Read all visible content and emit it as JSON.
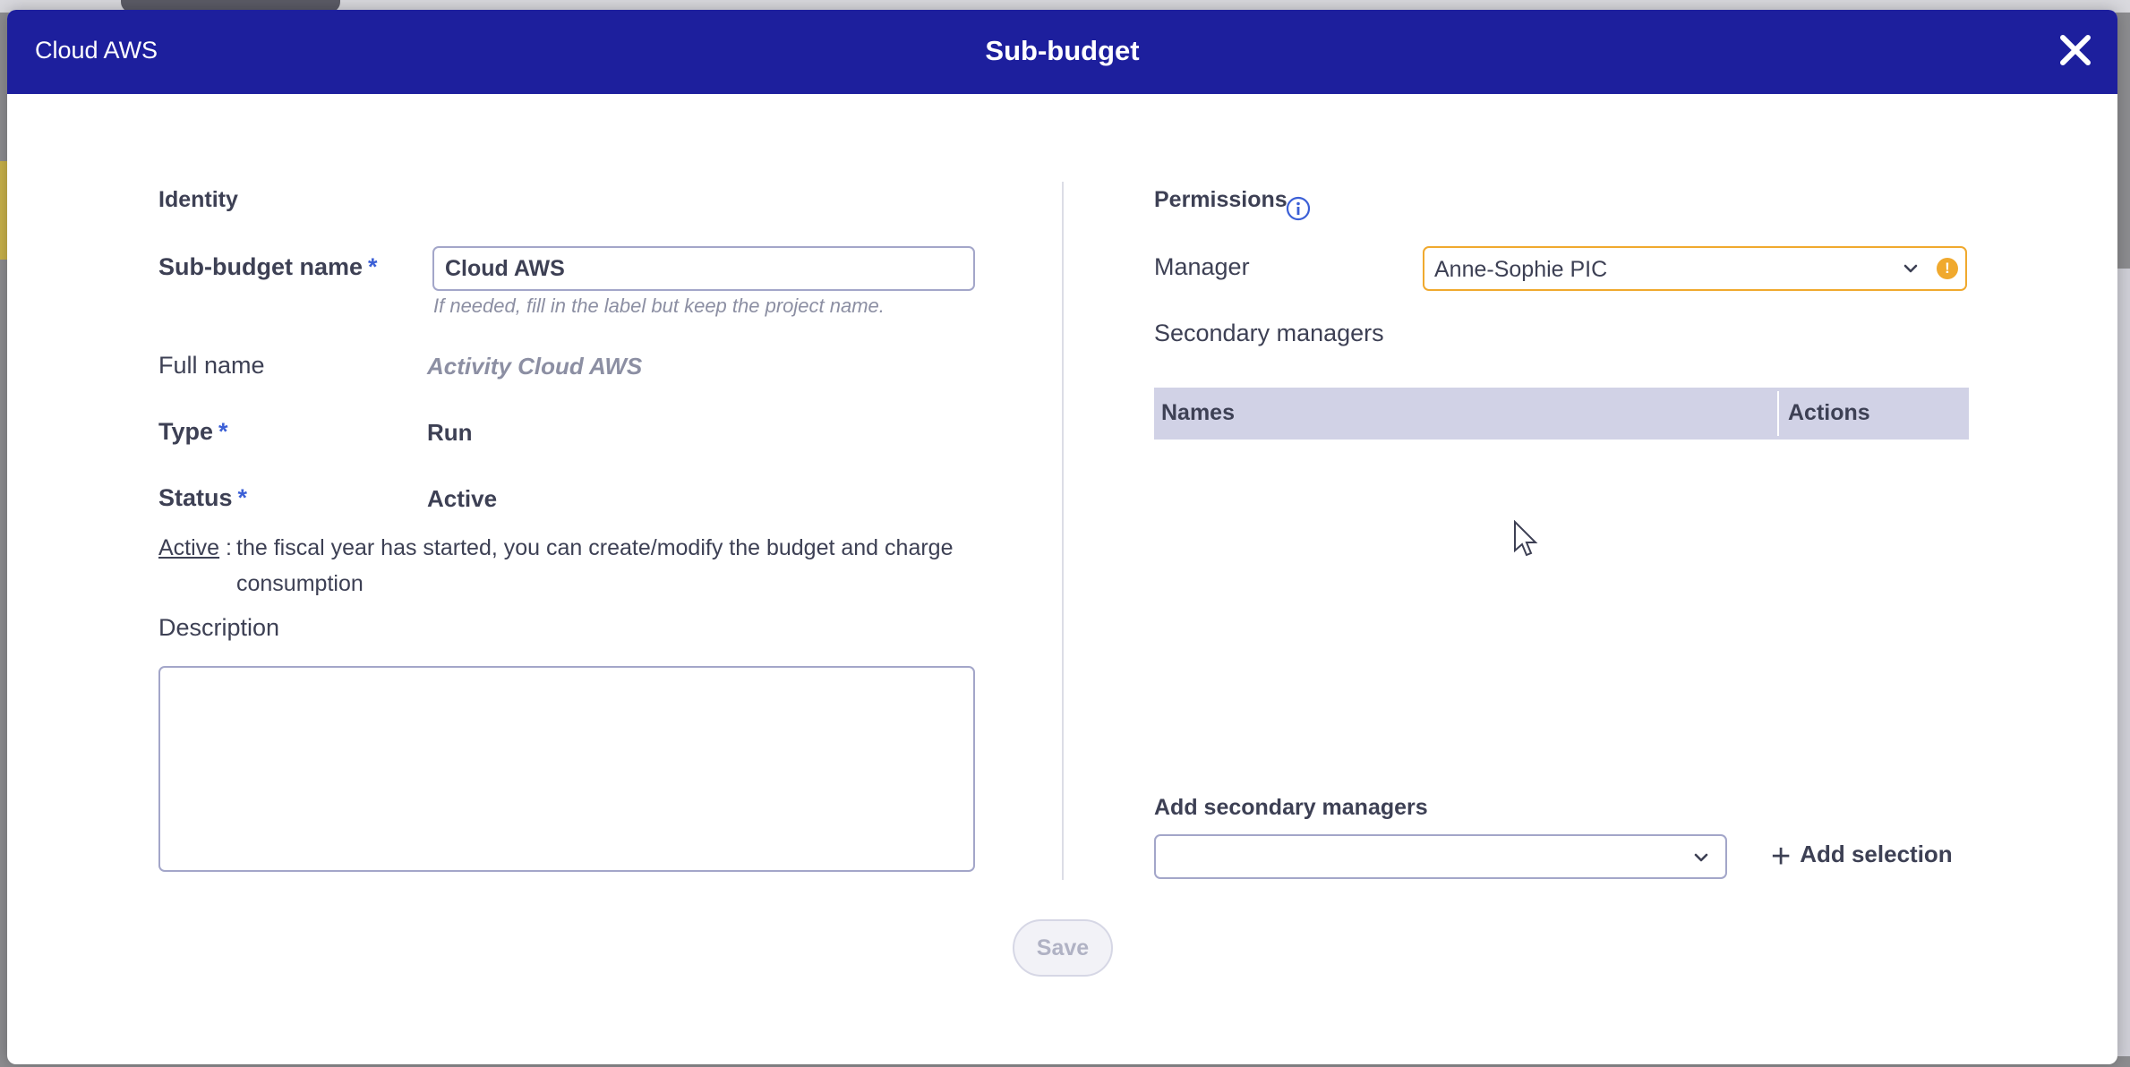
{
  "header": {
    "context": "Cloud AWS",
    "title": "Sub-budget",
    "close_icon": "close-icon"
  },
  "identity": {
    "section_title": "Identity",
    "name_label": "Sub-budget name",
    "name_value": "Cloud AWS",
    "name_hint": "If needed, fill in the label but keep the project name.",
    "fullname_label": "Full name",
    "fullname_value": "Activity Cloud AWS",
    "type_label": "Type",
    "type_value": "Run",
    "status_label": "Status",
    "status_value": "Active",
    "status_term": "Active",
    "status_colon": " :",
    "status_desc_line1": "the fiscal year has started, you can create/modify the budget and charge",
    "status_desc_line2": "consumption",
    "description_label": "Description",
    "description_value": "",
    "required_mark": "*"
  },
  "permissions": {
    "section_title": "Permissions",
    "info_icon": "info-icon",
    "manager_label": "Manager",
    "manager_value": "Anne-Sophie PIC",
    "manager_warning": "!",
    "secondary_label": "Secondary managers",
    "table_headers": [
      "Names",
      "Actions"
    ],
    "table_rows": [],
    "add_label": "Add secondary managers",
    "add_select_value": "",
    "add_button": "Add selection",
    "add_button_icon": "+"
  },
  "footer": {
    "save_label": "Save"
  },
  "colors": {
    "header_bg": "#1d1f9d",
    "warning": "#f0a92e",
    "required": "#3b5fd6",
    "table_header_bg": "#d1d2e6"
  }
}
